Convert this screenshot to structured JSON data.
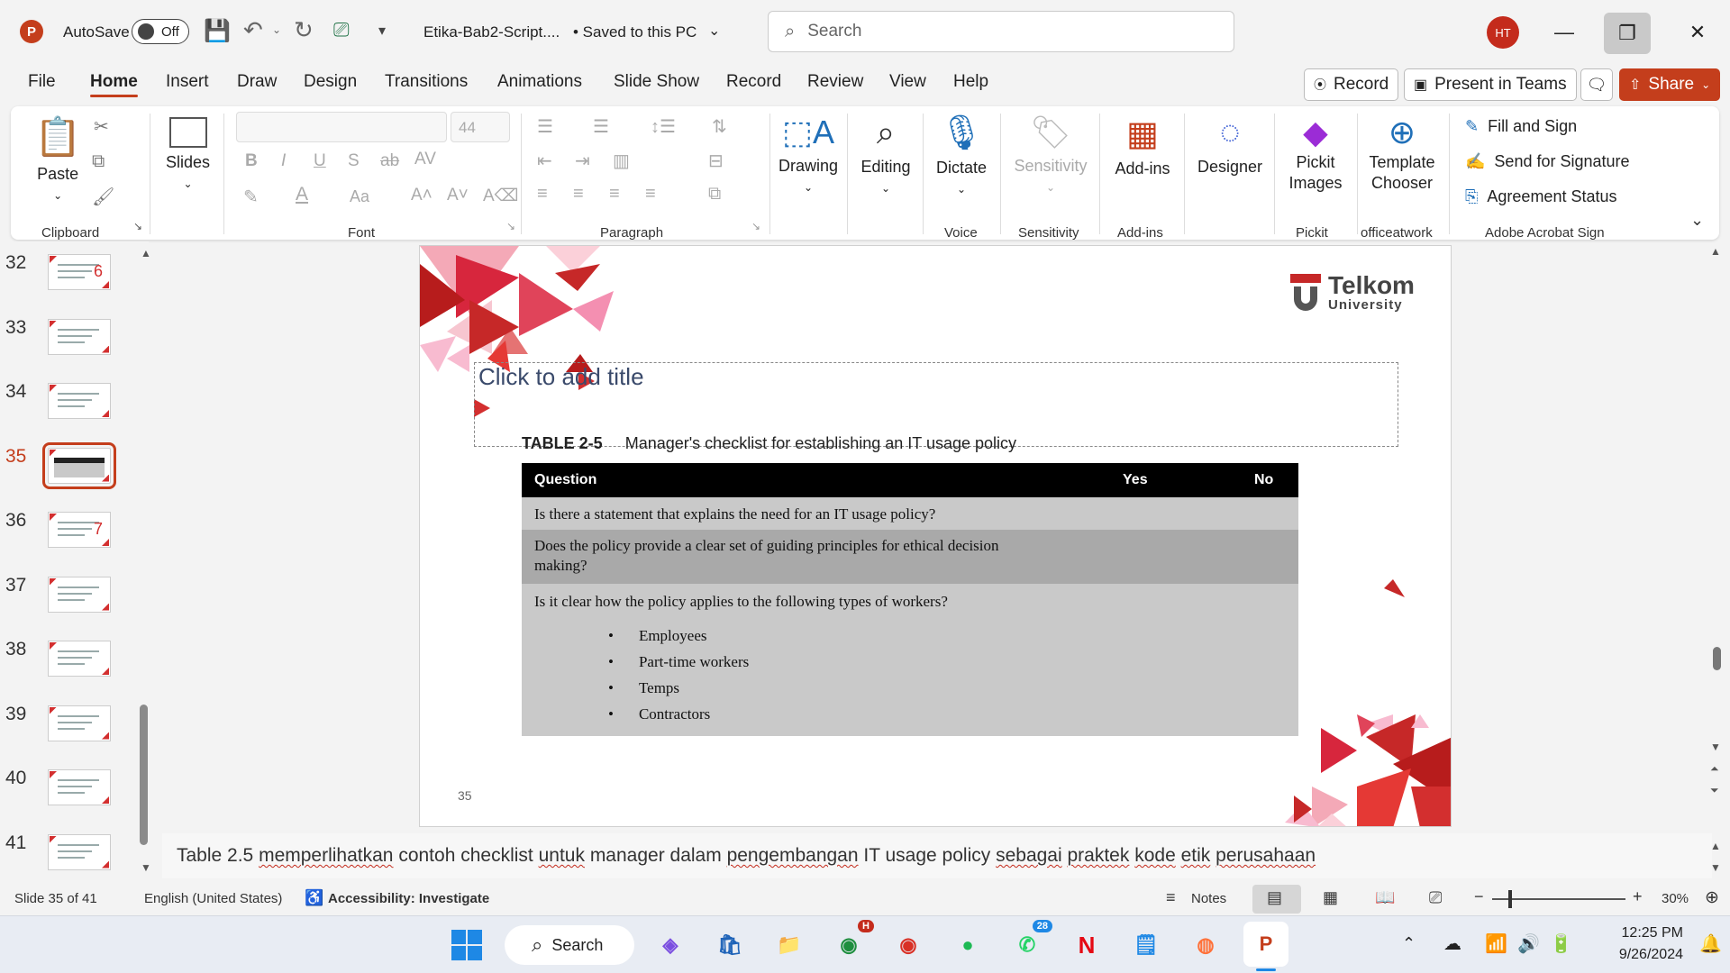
{
  "titlebar": {
    "autosave_label": "AutoSave",
    "autosave_state": "Off",
    "file_name": "Etika-Bab2-Script....",
    "save_state": "• Saved to this PC",
    "search_placeholder": "Search",
    "user_initials": "HT"
  },
  "menu": {
    "tabs": [
      "File",
      "Home",
      "Insert",
      "Draw",
      "Design",
      "Transitions",
      "Animations",
      "Slide Show",
      "Record",
      "Review",
      "View",
      "Help"
    ],
    "active": "Home",
    "record_label": "Record",
    "present_label": "Present in Teams",
    "share_label": "Share"
  },
  "ribbon": {
    "paste": "Paste",
    "slides": "Slides",
    "font_size": "44",
    "drawing": "Drawing",
    "editing": "Editing",
    "dictate": "Dictate",
    "sensitivity_btn": "Sensitivity",
    "addins_btn": "Add-ins",
    "designer": "Designer",
    "pickit_line1": "Pickit",
    "pickit_line2": "Images",
    "template_line1": "Template",
    "template_line2": "Chooser",
    "fill_sign": "Fill and Sign",
    "send_signature": "Send for Signature",
    "agreement_status": "Agreement Status",
    "groups": {
      "clipboard": "Clipboard",
      "font": "Font",
      "paragraph": "Paragraph",
      "voice": "Voice",
      "sensitivity": "Sensitivity",
      "addins": "Add-ins",
      "pickit": "Pickit",
      "officeatwork": "officeatwork",
      "adobe": "Adobe Acrobat Sign"
    }
  },
  "thumbnails": {
    "items": [
      {
        "num": "32",
        "label": "6"
      },
      {
        "num": "33",
        "label": ""
      },
      {
        "num": "34",
        "label": ""
      },
      {
        "num": "35",
        "label": ""
      },
      {
        "num": "36",
        "label": "7"
      },
      {
        "num": "37",
        "label": ""
      },
      {
        "num": "38",
        "label": ""
      },
      {
        "num": "39",
        "label": ""
      },
      {
        "num": "40",
        "label": ""
      },
      {
        "num": "41",
        "label": ""
      }
    ],
    "selected": "35"
  },
  "slide": {
    "logo_line1": "Telkom",
    "logo_line2": "University",
    "title_placeholder": "Click to add title",
    "table_caption_num": "TABLE 2-5",
    "table_caption_text": "Manager's checklist for establishing an IT usage policy",
    "table": {
      "headers": [
        "Question",
        "Yes",
        "No"
      ],
      "row1": "Is there a statement that explains the need for an IT usage policy?",
      "row2_line1": "Does the policy provide a clear set of guiding principles for ethical decision",
      "row2_line2": "making?",
      "row3": "Is it clear how the policy applies to the following types of workers?",
      "bullets": [
        "Employees",
        "Part-time workers",
        "Temps",
        "Contractors"
      ]
    },
    "page_number": "35"
  },
  "notes": {
    "words": [
      "Table 2.5",
      "memperlihatkan",
      "  contoh checklist",
      "untuk",
      "manager dalam",
      "pengembangan",
      "IT usage policy",
      "sebagai",
      "praktek",
      "kode",
      "etik",
      "perusahaan"
    ]
  },
  "status": {
    "slide_count": "Slide 35 of 41",
    "language": "English (United States)",
    "accessibility": "Accessibility: Investigate",
    "notes_label": "Notes",
    "zoom": "30%"
  },
  "taskbar": {
    "search_label": "Search",
    "chrome_badge": "H",
    "whatsapp_badge": "28",
    "time": "12:25 PM",
    "date": "9/26/2024"
  },
  "colors": {
    "accent": "#c43e1c",
    "slide_red": "#d32f2f"
  }
}
